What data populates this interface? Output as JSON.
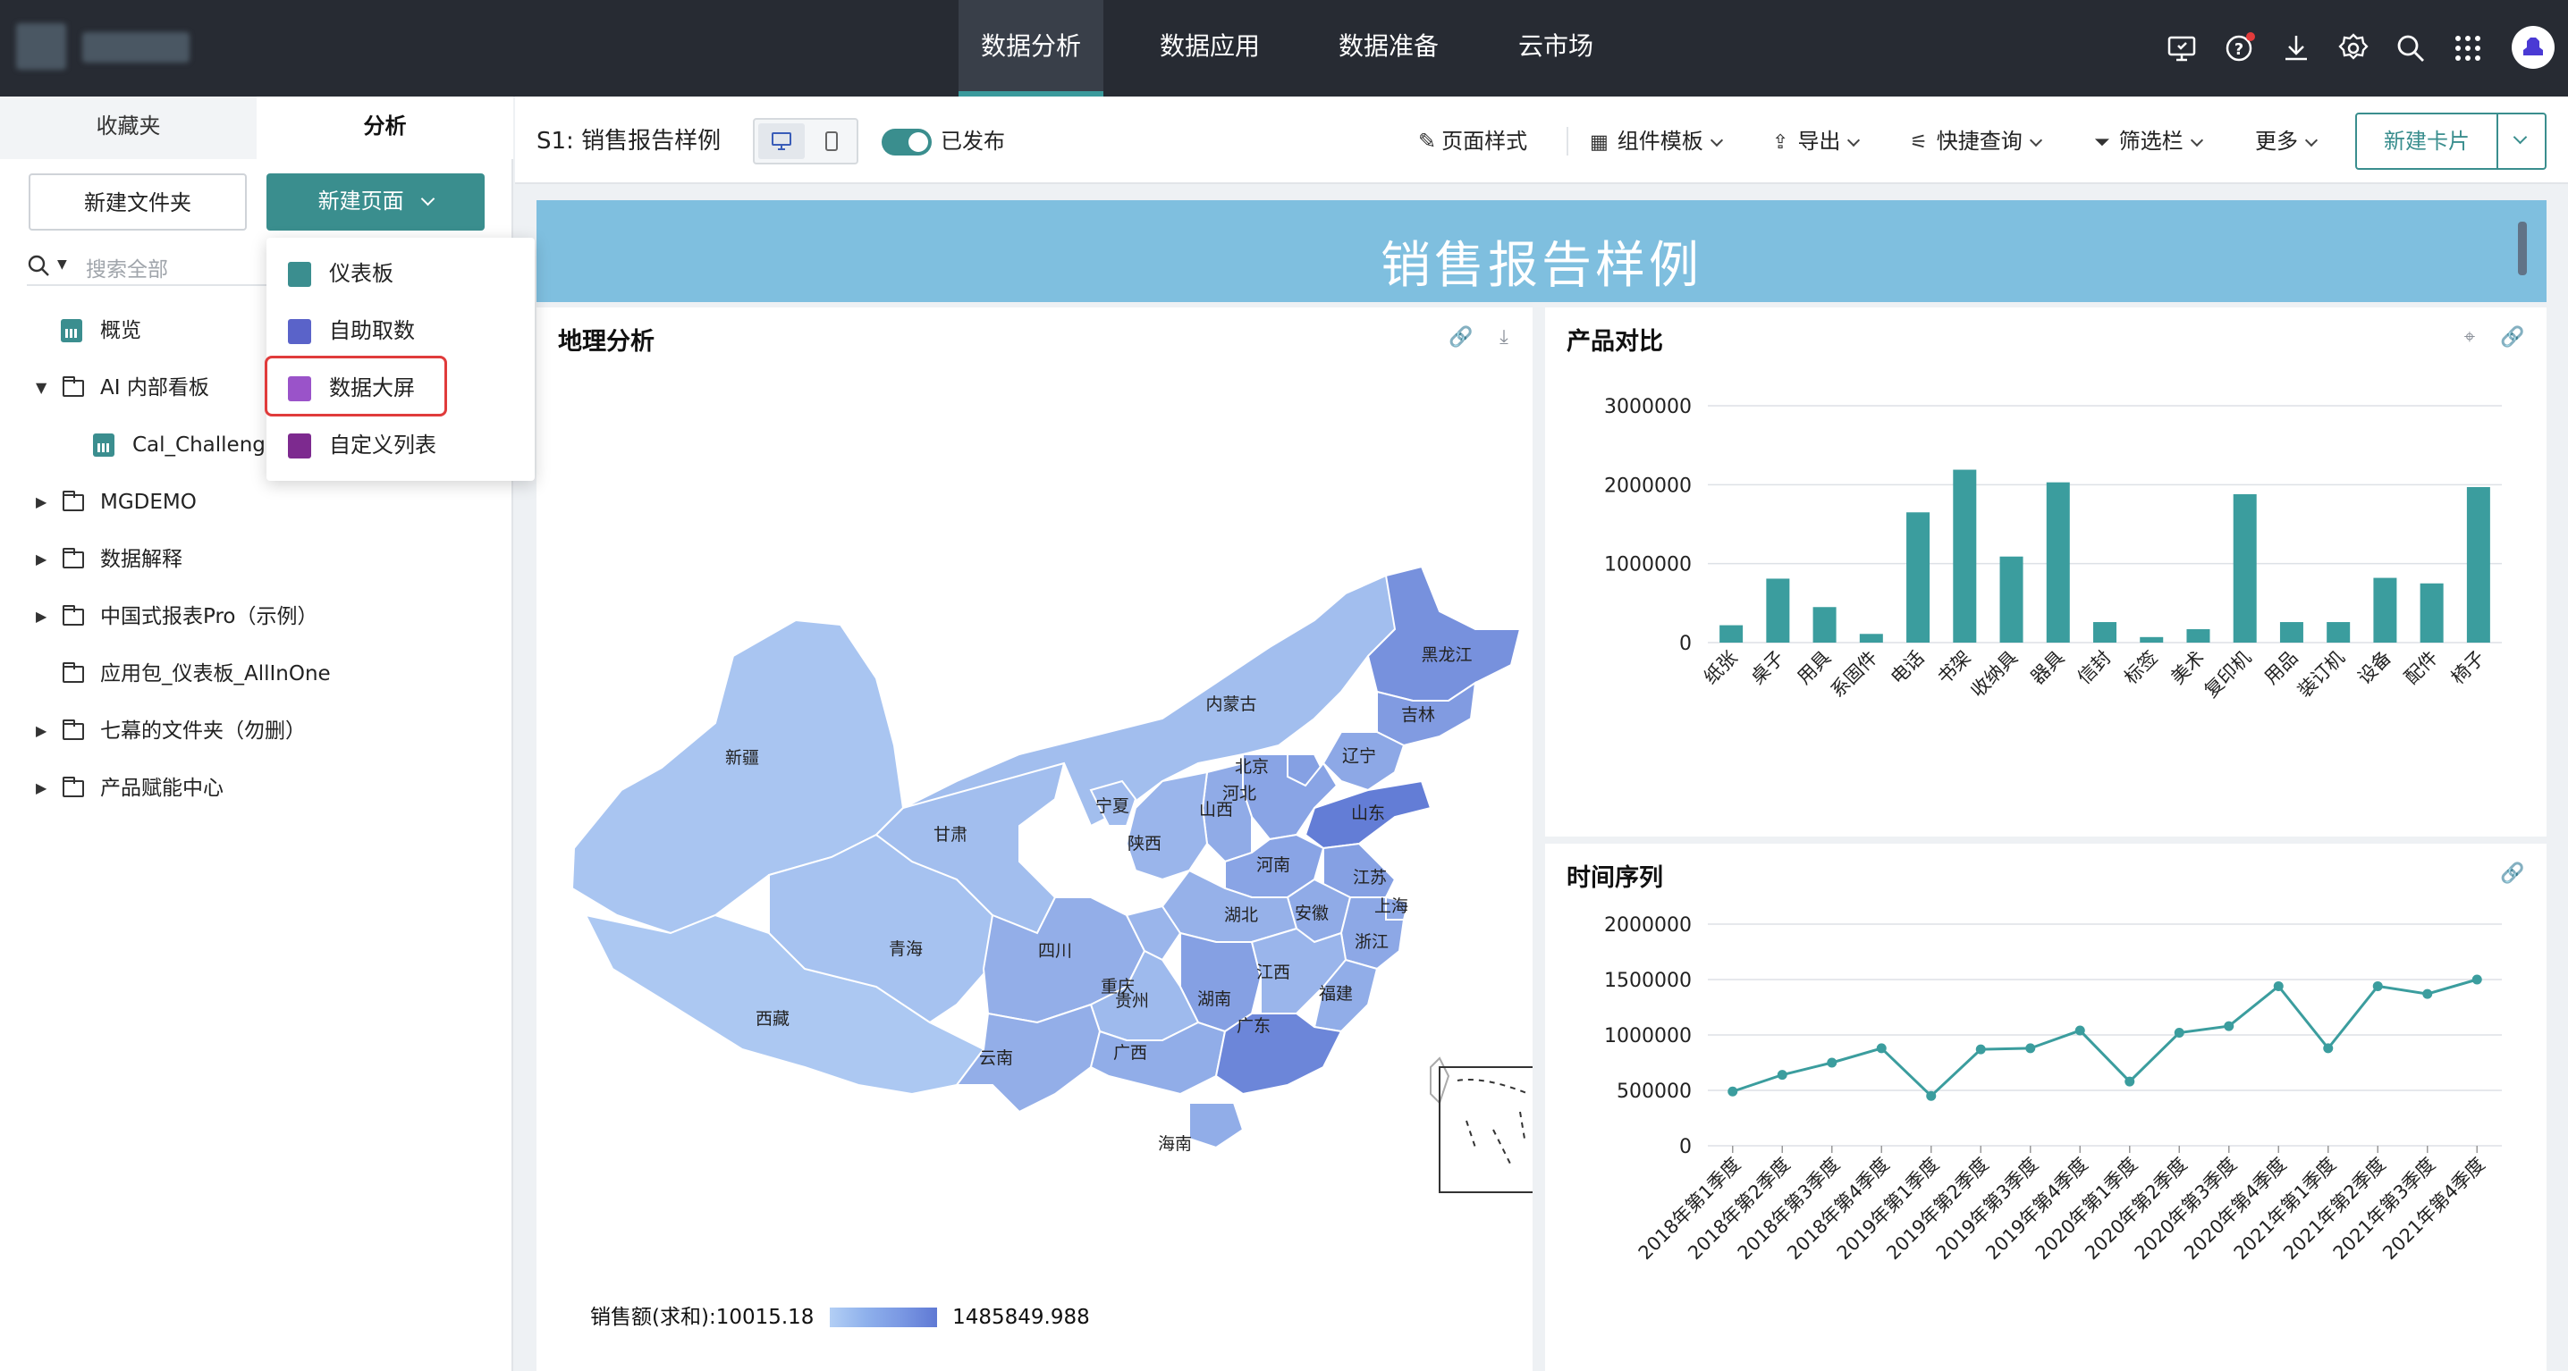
{
  "nav": {
    "items": [
      "数据分析",
      "数据应用",
      "数据准备",
      "云市场"
    ],
    "active_index": 0
  },
  "topbar_icons": [
    "monitor-icon",
    "help-icon",
    "download-icon",
    "settings-icon",
    "search-icon",
    "apps-grid-icon",
    "avatar"
  ],
  "sidebar": {
    "tabs": [
      "收藏夹",
      "分析"
    ],
    "active_tab": "分析",
    "new_folder_label": "新建文件夹",
    "new_page_label": "新建页面",
    "search_placeholder": "搜索全部",
    "tree": [
      {
        "label": "概览",
        "type": "dashboard",
        "level": 0,
        "expandable": false
      },
      {
        "label": "AI 内部看板",
        "type": "folder",
        "level": 0,
        "expanded": true
      },
      {
        "label": "Cal_Challeng",
        "type": "dashboard",
        "level": 1,
        "expandable": false
      },
      {
        "label": "MGDEMO",
        "type": "folder",
        "level": 0,
        "expanded": false
      },
      {
        "label": "数据解释",
        "type": "folder",
        "level": 0,
        "expanded": false
      },
      {
        "label": "中国式报表Pro（示例）",
        "type": "folder",
        "level": 0,
        "expanded": false
      },
      {
        "label": "应用包_仪表板_AllInOne",
        "type": "folder",
        "level": 0,
        "expandable": false
      },
      {
        "label": "七幕的文件夹（勿删）",
        "type": "folder",
        "level": 0,
        "expanded": false
      },
      {
        "label": "产品赋能中心",
        "type": "folder",
        "level": 0,
        "expanded": false
      }
    ]
  },
  "new_page_menu": {
    "items": [
      {
        "label": "仪表板",
        "icon": "dashboard-icon",
        "color": "#3b8e8f"
      },
      {
        "label": "自助取数",
        "icon": "self-fetch-icon",
        "color": "#5a63c9"
      },
      {
        "label": "数据大屏",
        "icon": "big-screen-icon",
        "color": "#9a53c9"
      },
      {
        "label": "自定义列表",
        "icon": "custom-list-icon",
        "color": "#7d2a8f"
      }
    ],
    "highlighted": "数据大屏"
  },
  "toolbar": {
    "page_name": "S1:  销售报告样例",
    "published_label": "已发布",
    "published": true,
    "page_style": "页面样式",
    "component_template": "组件模板",
    "export": "导出",
    "quick_query": "快捷查询",
    "filter_bar": "筛选栏",
    "more": "更多",
    "new_card": "新建卡片"
  },
  "colors": {
    "accent": "#3a9a9c",
    "bar": "#3b9d9e",
    "banner": "#7fbfdf",
    "topbar": "#272b33",
    "map_low": "#b3cff5",
    "map_high": "#5f79d4"
  },
  "report": {
    "title": "销售报告样例",
    "geo_card": {
      "title": "地理分析",
      "legend_label": "销售额(求和):10015.18",
      "legend_max": "1485849.988",
      "provinces": [
        {
          "name": "新疆",
          "level": 0.12
        },
        {
          "name": "西藏",
          "level": 0.08
        },
        {
          "name": "青海",
          "level": 0.15
        },
        {
          "name": "甘肃",
          "level": 0.2
        },
        {
          "name": "内蒙古",
          "level": 0.2
        },
        {
          "name": "黑龙江",
          "level": 0.72
        },
        {
          "name": "吉林",
          "level": 0.6
        },
        {
          "name": "辽宁",
          "level": 0.45
        },
        {
          "name": "北京",
          "level": 0.55
        },
        {
          "name": "河北",
          "level": 0.5
        },
        {
          "name": "山西",
          "level": 0.42
        },
        {
          "name": "宁夏",
          "level": 0.22
        },
        {
          "name": "陕西",
          "level": 0.3
        },
        {
          "name": "山东",
          "level": 0.95
        },
        {
          "name": "河南",
          "level": 0.5
        },
        {
          "name": "江苏",
          "level": 0.55
        },
        {
          "name": "安徽",
          "level": 0.42
        },
        {
          "name": "上海",
          "level": 0.45
        },
        {
          "name": "四川",
          "level": 0.38
        },
        {
          "name": "重庆",
          "level": 0.3
        },
        {
          "name": "湖北",
          "level": 0.35
        },
        {
          "name": "浙江",
          "level": 0.45
        },
        {
          "name": "湖南",
          "level": 0.55
        },
        {
          "name": "江西",
          "level": 0.3
        },
        {
          "name": "贵州",
          "level": 0.25
        },
        {
          "name": "福建",
          "level": 0.4
        },
        {
          "name": "云南",
          "level": 0.38
        },
        {
          "name": "广西",
          "level": 0.4
        },
        {
          "name": "广东",
          "level": 0.85
        },
        {
          "name": "海南",
          "level": 0.4
        }
      ]
    },
    "product_card": {
      "title": "产品对比"
    },
    "time_card": {
      "title": "时间序列"
    }
  },
  "chart_data": [
    {
      "type": "bar",
      "title": "产品对比",
      "categories": [
        "纸张",
        "桌子",
        "用具",
        "系固件",
        "电话",
        "书架",
        "收纳具",
        "器具",
        "信封",
        "标签",
        "美术",
        "复印机",
        "用品",
        "装订机",
        "设备",
        "配件",
        "椅子"
      ],
      "values": [
        220000,
        810000,
        450000,
        110000,
        1650000,
        2190000,
        1090000,
        2030000,
        260000,
        70000,
        170000,
        1880000,
        260000,
        260000,
        820000,
        750000,
        1970000
      ],
      "yticks": [
        "0",
        "1000000",
        "2000000",
        "3000000"
      ],
      "ylim": [
        0,
        3000000
      ],
      "grid": true
    },
    {
      "type": "line",
      "title": "时间序列",
      "categories": [
        "2018年第1季度",
        "2018年第2季度",
        "2018年第3季度",
        "2018年第4季度",
        "2019年第1季度",
        "2019年第2季度",
        "2019年第3季度",
        "2019年第4季度",
        "2020年第1季度",
        "2020年第2季度",
        "2020年第3季度",
        "2020年第4季度",
        "2021年第1季度",
        "2021年第2季度",
        "2021年第3季度",
        "2021年第4季度"
      ],
      "values": [
        490000,
        640000,
        750000,
        880000,
        450000,
        870000,
        880000,
        1040000,
        580000,
        1020000,
        1080000,
        1440000,
        880000,
        1440000,
        1370000,
        1500000
      ],
      "yticks": [
        "0",
        "500000",
        "1000000",
        "1500000",
        "2000000"
      ],
      "ylim": [
        0,
        2000000
      ],
      "grid": true
    }
  ]
}
